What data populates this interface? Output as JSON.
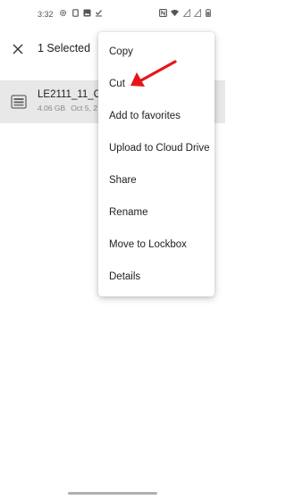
{
  "status_bar": {
    "time": "3:32",
    "left_icons": [
      "gear-icon",
      "sim-icon",
      "image-icon",
      "download-done-icon"
    ],
    "right_icons": [
      "nfc-icon",
      "wifi-icon",
      "sim-signal-icon",
      "sim-signal-icon",
      "battery-icon"
    ]
  },
  "app_bar": {
    "close_icon": "close-icon",
    "title": "1 Selected"
  },
  "file": {
    "icon": "archive-file-icon",
    "name": "LE2111_11_C_C",
    "size": "4.06 GB",
    "date": "Oct 5, 2"
  },
  "context_menu": {
    "items": [
      {
        "label": "Copy"
      },
      {
        "label": "Cut"
      },
      {
        "label": "Add to favorites"
      },
      {
        "label": "Upload to Cloud Drive"
      },
      {
        "label": "Share"
      },
      {
        "label": "Rename"
      },
      {
        "label": "Move to Lockbox"
      },
      {
        "label": "Details"
      }
    ]
  },
  "annotation": {
    "icon": "red-arrow-icon",
    "color": "#e8141b"
  }
}
